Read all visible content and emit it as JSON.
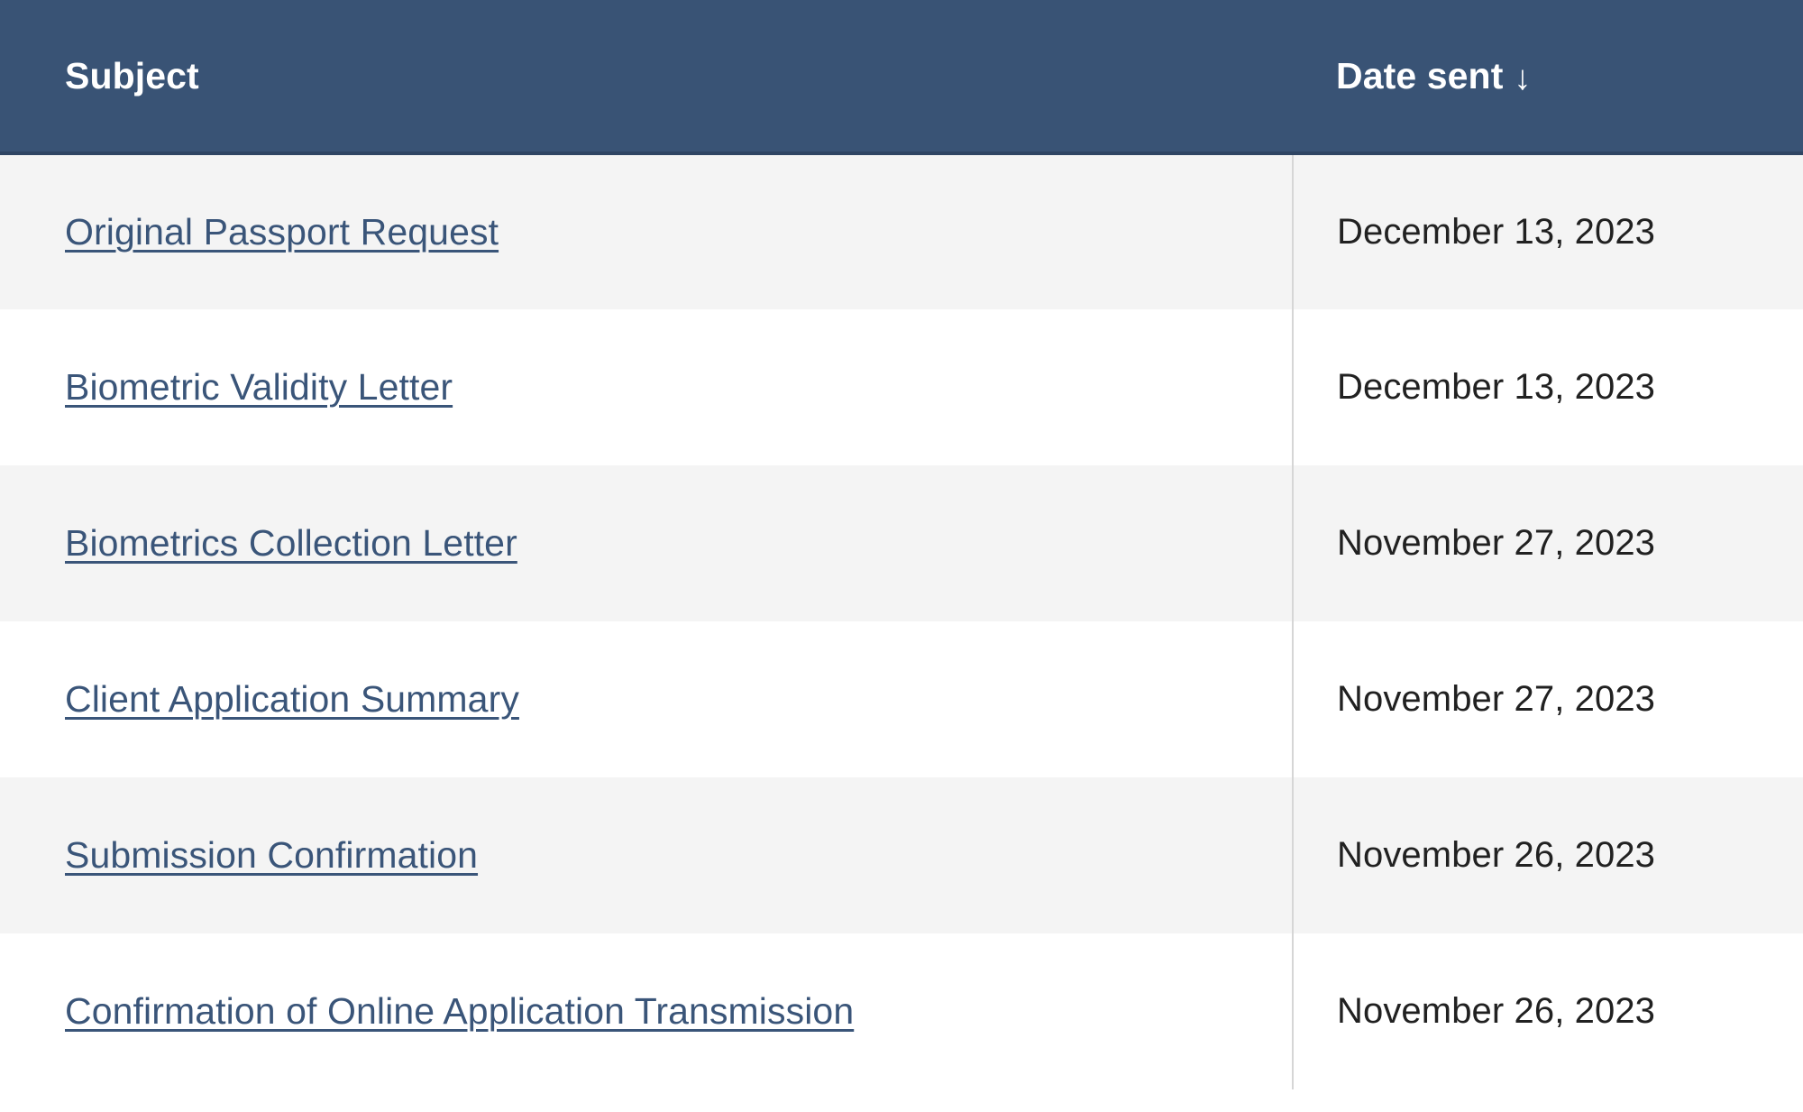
{
  "table": {
    "columns": [
      {
        "key": "subject",
        "label": "Subject",
        "sortable": true,
        "sorted": false,
        "sort_indicator": ""
      },
      {
        "key": "date_sent",
        "label": "Date sent",
        "sortable": true,
        "sorted": true,
        "sort_direction": "descending",
        "sort_indicator": "↓"
      }
    ],
    "rows": [
      {
        "subject": "Original Passport Request",
        "date_sent": "December 13, 2023"
      },
      {
        "subject": "Biometric Validity Letter",
        "date_sent": "December 13, 2023"
      },
      {
        "subject": "Biometrics Collection Letter",
        "date_sent": "November 27, 2023"
      },
      {
        "subject": "Client Application Summary",
        "date_sent": "November 27, 2023"
      },
      {
        "subject": "Submission Confirmation",
        "date_sent": "November 26, 2023"
      },
      {
        "subject": "Confirmation of Online Application Transmission",
        "date_sent": "November 26, 2023"
      }
    ]
  },
  "colors": {
    "header_background": "#395375",
    "header_text": "#ffffff",
    "header_border": "#2f4563",
    "row_striped": "#f4f4f4",
    "row_plain": "#ffffff",
    "link": "#3a5579",
    "cell_text": "#1b1b1b",
    "column_divider": "#d6d6d6"
  }
}
